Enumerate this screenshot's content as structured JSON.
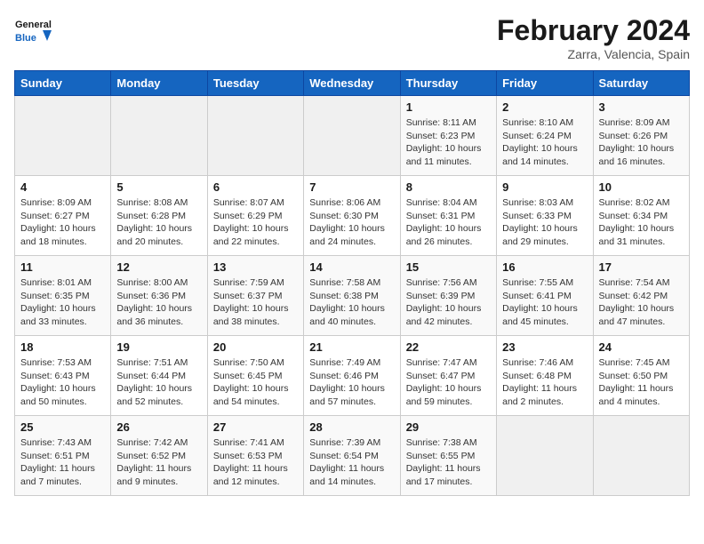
{
  "header": {
    "logo_general": "General",
    "logo_blue": "Blue",
    "month": "February 2024",
    "location": "Zarra, Valencia, Spain"
  },
  "days_of_week": [
    "Sunday",
    "Monday",
    "Tuesday",
    "Wednesday",
    "Thursday",
    "Friday",
    "Saturday"
  ],
  "weeks": [
    [
      {
        "num": "",
        "info": ""
      },
      {
        "num": "",
        "info": ""
      },
      {
        "num": "",
        "info": ""
      },
      {
        "num": "",
        "info": ""
      },
      {
        "num": "1",
        "info": "Sunrise: 8:11 AM\nSunset: 6:23 PM\nDaylight: 10 hours\nand 11 minutes."
      },
      {
        "num": "2",
        "info": "Sunrise: 8:10 AM\nSunset: 6:24 PM\nDaylight: 10 hours\nand 14 minutes."
      },
      {
        "num": "3",
        "info": "Sunrise: 8:09 AM\nSunset: 6:26 PM\nDaylight: 10 hours\nand 16 minutes."
      }
    ],
    [
      {
        "num": "4",
        "info": "Sunrise: 8:09 AM\nSunset: 6:27 PM\nDaylight: 10 hours\nand 18 minutes."
      },
      {
        "num": "5",
        "info": "Sunrise: 8:08 AM\nSunset: 6:28 PM\nDaylight: 10 hours\nand 20 minutes."
      },
      {
        "num": "6",
        "info": "Sunrise: 8:07 AM\nSunset: 6:29 PM\nDaylight: 10 hours\nand 22 minutes."
      },
      {
        "num": "7",
        "info": "Sunrise: 8:06 AM\nSunset: 6:30 PM\nDaylight: 10 hours\nand 24 minutes."
      },
      {
        "num": "8",
        "info": "Sunrise: 8:04 AM\nSunset: 6:31 PM\nDaylight: 10 hours\nand 26 minutes."
      },
      {
        "num": "9",
        "info": "Sunrise: 8:03 AM\nSunset: 6:33 PM\nDaylight: 10 hours\nand 29 minutes."
      },
      {
        "num": "10",
        "info": "Sunrise: 8:02 AM\nSunset: 6:34 PM\nDaylight: 10 hours\nand 31 minutes."
      }
    ],
    [
      {
        "num": "11",
        "info": "Sunrise: 8:01 AM\nSunset: 6:35 PM\nDaylight: 10 hours\nand 33 minutes."
      },
      {
        "num": "12",
        "info": "Sunrise: 8:00 AM\nSunset: 6:36 PM\nDaylight: 10 hours\nand 36 minutes."
      },
      {
        "num": "13",
        "info": "Sunrise: 7:59 AM\nSunset: 6:37 PM\nDaylight: 10 hours\nand 38 minutes."
      },
      {
        "num": "14",
        "info": "Sunrise: 7:58 AM\nSunset: 6:38 PM\nDaylight: 10 hours\nand 40 minutes."
      },
      {
        "num": "15",
        "info": "Sunrise: 7:56 AM\nSunset: 6:39 PM\nDaylight: 10 hours\nand 42 minutes."
      },
      {
        "num": "16",
        "info": "Sunrise: 7:55 AM\nSunset: 6:41 PM\nDaylight: 10 hours\nand 45 minutes."
      },
      {
        "num": "17",
        "info": "Sunrise: 7:54 AM\nSunset: 6:42 PM\nDaylight: 10 hours\nand 47 minutes."
      }
    ],
    [
      {
        "num": "18",
        "info": "Sunrise: 7:53 AM\nSunset: 6:43 PM\nDaylight: 10 hours\nand 50 minutes."
      },
      {
        "num": "19",
        "info": "Sunrise: 7:51 AM\nSunset: 6:44 PM\nDaylight: 10 hours\nand 52 minutes."
      },
      {
        "num": "20",
        "info": "Sunrise: 7:50 AM\nSunset: 6:45 PM\nDaylight: 10 hours\nand 54 minutes."
      },
      {
        "num": "21",
        "info": "Sunrise: 7:49 AM\nSunset: 6:46 PM\nDaylight: 10 hours\nand 57 minutes."
      },
      {
        "num": "22",
        "info": "Sunrise: 7:47 AM\nSunset: 6:47 PM\nDaylight: 10 hours\nand 59 minutes."
      },
      {
        "num": "23",
        "info": "Sunrise: 7:46 AM\nSunset: 6:48 PM\nDaylight: 11 hours\nand 2 minutes."
      },
      {
        "num": "24",
        "info": "Sunrise: 7:45 AM\nSunset: 6:50 PM\nDaylight: 11 hours\nand 4 minutes."
      }
    ],
    [
      {
        "num": "25",
        "info": "Sunrise: 7:43 AM\nSunset: 6:51 PM\nDaylight: 11 hours\nand 7 minutes."
      },
      {
        "num": "26",
        "info": "Sunrise: 7:42 AM\nSunset: 6:52 PM\nDaylight: 11 hours\nand 9 minutes."
      },
      {
        "num": "27",
        "info": "Sunrise: 7:41 AM\nSunset: 6:53 PM\nDaylight: 11 hours\nand 12 minutes."
      },
      {
        "num": "28",
        "info": "Sunrise: 7:39 AM\nSunset: 6:54 PM\nDaylight: 11 hours\nand 14 minutes."
      },
      {
        "num": "29",
        "info": "Sunrise: 7:38 AM\nSunset: 6:55 PM\nDaylight: 11 hours\nand 17 minutes."
      },
      {
        "num": "",
        "info": ""
      },
      {
        "num": "",
        "info": ""
      }
    ]
  ]
}
